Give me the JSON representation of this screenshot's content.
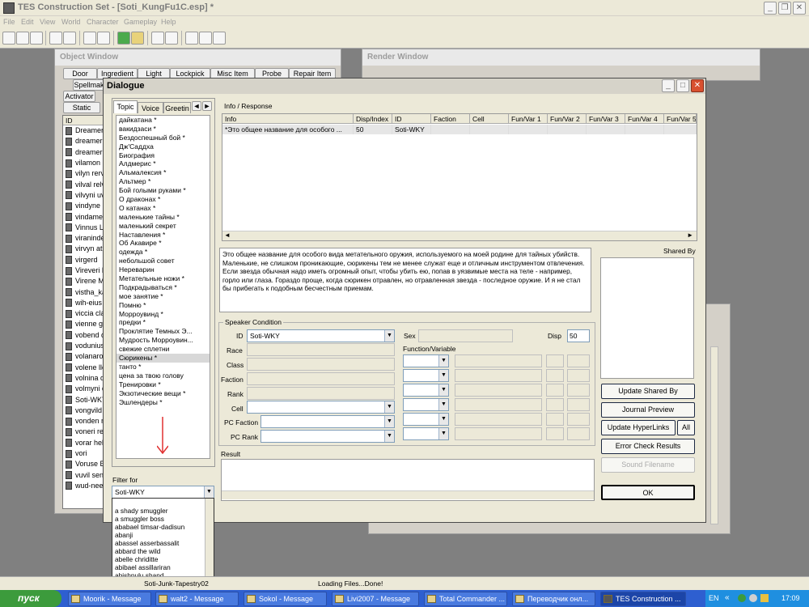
{
  "app": {
    "title": "TES Construction Set - [Soti_KungFu1C.esp] *"
  },
  "menu": [
    "File",
    "Edit",
    "View",
    "World",
    "Character",
    "Gameplay",
    "Help"
  ],
  "object_window": {
    "title": "Object Window",
    "tabs_row1": [
      "Door",
      "Ingredient",
      "Light",
      "Lockpick",
      "Misc Item",
      "Probe",
      "Repair Item"
    ],
    "tabs_row2": [
      "Spellmak"
    ],
    "tabs_row3": [
      "Activator"
    ],
    "tabs_row4": [
      "Static"
    ],
    "column_header": "ID",
    "rows": [
      "Dreamer_",
      "dreamer p",
      "dreamer w",
      "vilamon",
      "vilyn rerva",
      "vilval relv",
      "vilvyni uvi",
      "vindyne b",
      "vindamea",
      "Vinnus La",
      "viraninde",
      "virvyn ath",
      "virgerd",
      "Vireveri D",
      "Virene Me",
      "vistha_ka",
      "wih-eius",
      "viccia cla",
      "vienne gil",
      "vobend d",
      "vodunius",
      "volanaro",
      "volene lle",
      "volnina qu",
      "volmyni di",
      "Soti-WKY",
      "vongvild",
      "vonden m",
      "voneri rer",
      "vorar hela",
      "vori",
      "Voruse Be",
      "vuvil seni",
      "wud-neeu"
    ]
  },
  "render_window": {
    "title": "Render Window"
  },
  "dialogue": {
    "title": "Dialogue",
    "tabs": [
      "Topic",
      "Voice",
      "Greetin"
    ],
    "topics": [
      "дайкатана *",
      "вакидзаси *",
      "Бездоспешный бой *",
      "Дж'Саддха",
      "Биография",
      "Алдмерис *",
      "Альмалексия *",
      "Альтмер *",
      "Бой голыми руками *",
      "О драконах *",
      "О катанах *",
      "маленькие тайны *",
      "маленький секрет",
      "Наставления *",
      "Об Акавире *",
      "одежда *",
      "небольшой совет",
      "Нереварин",
      "Метательные ножи *",
      "Подкрадываться *",
      "мое занятие *",
      "Помню *",
      "Морроувинд *",
      "предки *",
      "Проклятие Темных Э...",
      "Мудрость Морроувин...",
      "свежие сплетни",
      "Сюрикены *",
      "танто *",
      "цена за твою голову",
      "Тренировки *",
      "Экзотические вещи *",
      "Эшлендеры *"
    ],
    "selected_topic": "Сюрикены *",
    "filter_label": "Filter for",
    "filter_value": "Soti-WKY",
    "filter_options": [
      "a shady smuggler",
      "a smuggler boss",
      "ababael timsar-dadisun",
      "abanji",
      "abassel asserbassalit",
      "abbard the wild",
      "abelle chriditte",
      "abibael assillariran",
      "abishpulu shand"
    ],
    "info_label": "Info / Response",
    "columns": [
      "Info",
      "Disp/Index",
      "ID",
      "Faction",
      "Cell",
      "Fun/Var 1",
      "Fun/Var 2",
      "Fun/Var 3",
      "Fun/Var 4",
      "Fun/Var 5"
    ],
    "rows": [
      [
        "*Это общее название для особого ...",
        "50",
        "Soti-WKY",
        "",
        "",
        "",
        "",
        "",
        "",
        ""
      ]
    ],
    "response": "Это общее название для особого вида метательного оружия, используемого на моей родине для тайных убийств. Маленькие, не слишком проникающие, сюрикены тем не менее служат еще и отличным инструментом отвлечения. Если звезда обычная надо иметь огромный опыт, чтобы убить ею, попав в уязвимые места на теле - например, горло или глаза. Гораздо проще, когда сюрикен отравлен, но отравленная звезда - последное оружие. И я не стал бы прибегать к подобным бесчестным приемам.",
    "shared_by_label": "Shared By",
    "speaker_condition_label": "Speaker Condition",
    "labels": {
      "id": "ID",
      "race": "Race",
      "class": "Class",
      "faction": "Faction",
      "rank": "Rank",
      "cell": "Cell",
      "pc_faction": "PC Faction",
      "pc_rank": "PC Rank",
      "sex": "Sex",
      "disp": "Disp",
      "function_variable": "Function/Variable",
      "result": "Result"
    },
    "id_value": "Soti-WKY",
    "disp_value": "50",
    "buttons": {
      "update_shared_by": "Update Shared By",
      "journal_preview": "Journal Preview",
      "update_hyperlinks": "Update HyperLinks",
      "all": "All",
      "error_check": "Error Check Results",
      "sound_filename": "Sound Filename",
      "ok": "OK"
    }
  },
  "status": {
    "left": "Soti-Junk-Tapestry02",
    "right": "Loading Files...Done!"
  },
  "taskbar": {
    "start": "пуск",
    "items": [
      "Moorik - Message",
      "walt2 - Message",
      "Sokol - Message",
      "Livi2007 - Message",
      "Total Commander ...",
      "Переводчик онл...",
      "TES Construction ..."
    ],
    "lang": "EN",
    "time": "17:09"
  },
  "colors": {
    "taskbar": "#2e5fd0",
    "start": "#3c9b3c",
    "dialog_bg": "#ece9d8",
    "close": "#d8502f"
  }
}
